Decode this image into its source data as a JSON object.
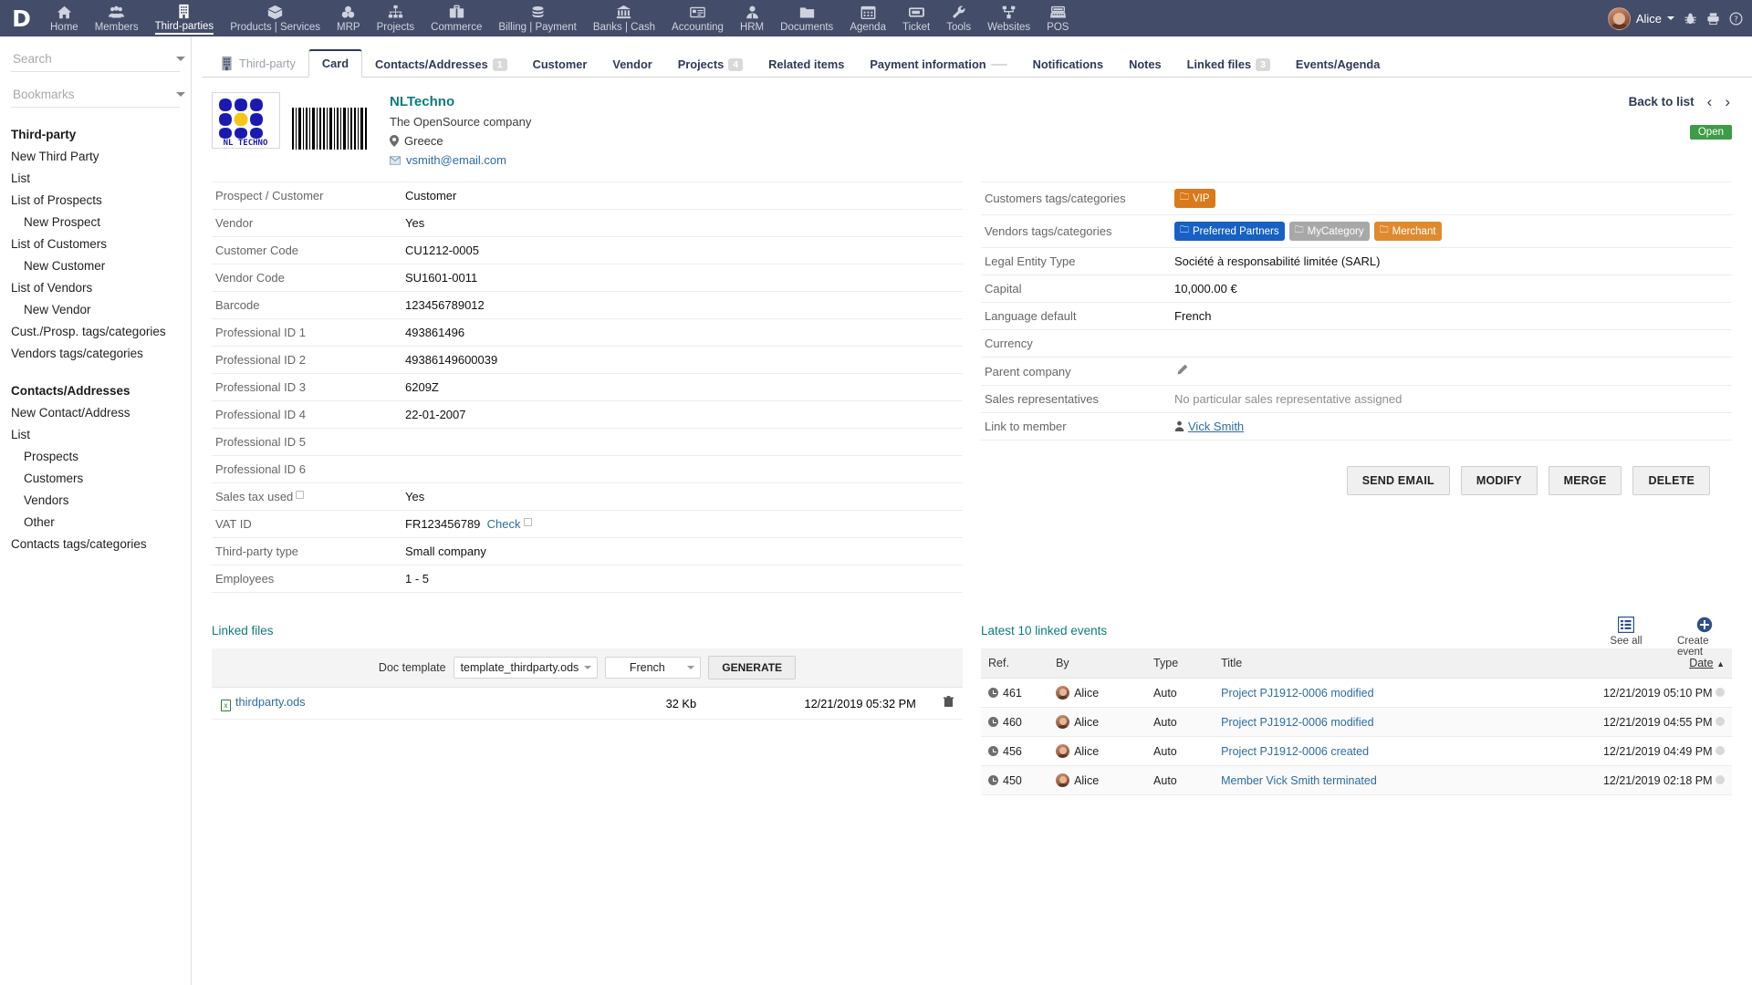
{
  "topnav": {
    "logo": "D",
    "items": [
      {
        "label": "Home",
        "icon": "home-icon",
        "active": false
      },
      {
        "label": "Members",
        "icon": "members-icon",
        "active": false
      },
      {
        "label": "Third-parties",
        "icon": "building-icon",
        "active": true
      },
      {
        "label": "Products | Services",
        "icon": "box-icon",
        "active": false
      },
      {
        "label": "MRP",
        "icon": "mrp-icon",
        "active": false
      },
      {
        "label": "Projects",
        "icon": "projects-icon",
        "active": false
      },
      {
        "label": "Commerce",
        "icon": "briefcase-icon",
        "active": false
      },
      {
        "label": "Billing | Payment",
        "icon": "coins-icon",
        "active": false
      },
      {
        "label": "Banks | Cash",
        "icon": "bank-icon",
        "active": false
      },
      {
        "label": "Accounting",
        "icon": "accounting-icon",
        "active": false
      },
      {
        "label": "HRM",
        "icon": "hrm-icon",
        "active": false
      },
      {
        "label": "Documents",
        "icon": "folder-icon",
        "active": false
      },
      {
        "label": "Agenda",
        "icon": "calendar-icon",
        "active": false
      },
      {
        "label": "Ticket",
        "icon": "ticket-icon",
        "active": false
      },
      {
        "label": "Tools",
        "icon": "wrench-icon",
        "active": false
      },
      {
        "label": "Websites",
        "icon": "websites-icon",
        "active": false
      },
      {
        "label": "POS",
        "icon": "pos-icon",
        "active": false
      }
    ],
    "user_name": "Alice",
    "right_icons": [
      "bug-icon",
      "print-icon",
      "help-icon"
    ]
  },
  "sidebar": {
    "search_placeholder": "Search",
    "bookmarks_placeholder": "Bookmarks",
    "groups": [
      {
        "title": "Third-party",
        "items": [
          {
            "label": "New Third Party",
            "indent": false
          },
          {
            "label": "List",
            "indent": false
          },
          {
            "label": "List of Prospects",
            "indent": false
          },
          {
            "label": "New Prospect",
            "indent": true
          },
          {
            "label": "List of Customers",
            "indent": false
          },
          {
            "label": "New Customer",
            "indent": true
          },
          {
            "label": "List of Vendors",
            "indent": false
          },
          {
            "label": "New Vendor",
            "indent": true
          },
          {
            "label": "Cust./Prosp. tags/categories",
            "indent": false
          },
          {
            "label": "Vendors tags/categories",
            "indent": false
          }
        ]
      },
      {
        "title": "Contacts/Addresses",
        "items": [
          {
            "label": "New Contact/Address",
            "indent": false
          },
          {
            "label": "List",
            "indent": false
          },
          {
            "label": "Prospects",
            "indent": true
          },
          {
            "label": "Customers",
            "indent": true
          },
          {
            "label": "Vendors",
            "indent": true
          },
          {
            "label": "Other",
            "indent": true
          },
          {
            "label": "Contacts tags/categories",
            "indent": false
          }
        ]
      }
    ]
  },
  "tabs": [
    {
      "label": "Third-party",
      "badge": null,
      "active": false,
      "muted": true,
      "icon": "building-icon"
    },
    {
      "label": "Card",
      "badge": null,
      "active": true,
      "muted": false
    },
    {
      "label": "Contacts/Addresses",
      "badge": "1",
      "active": false,
      "muted": false
    },
    {
      "label": "Customer",
      "badge": null,
      "active": false,
      "muted": false
    },
    {
      "label": "Vendor",
      "badge": null,
      "active": false,
      "muted": false
    },
    {
      "label": "Projects",
      "badge": "4",
      "active": false,
      "muted": false
    },
    {
      "label": "Related items",
      "badge": null,
      "active": false,
      "muted": false
    },
    {
      "label": "Payment information",
      "badge": "",
      "active": false,
      "muted": false
    },
    {
      "label": "Notifications",
      "badge": null,
      "active": false,
      "muted": false
    },
    {
      "label": "Notes",
      "badge": null,
      "active": false,
      "muted": false
    },
    {
      "label": "Linked files",
      "badge": "3",
      "active": false,
      "muted": false
    },
    {
      "label": "Events/Agenda",
      "badge": null,
      "active": false,
      "muted": false
    }
  ],
  "card_header": {
    "company_name": "NLTechno",
    "tagline": "The OpenSource company",
    "country": "Greece",
    "email": "vsmith@email.com",
    "back_to_list": "Back to list",
    "prev_arrow": "‹",
    "next_arrow": "›",
    "status": "Open",
    "status_color": "#3d9c46",
    "logo_text": "NL TECHNO"
  },
  "left_fields": [
    {
      "label": "Prospect / Customer",
      "value": "Customer"
    },
    {
      "label": "Vendor",
      "value": "Yes"
    },
    {
      "label": "Customer Code",
      "value": "CU1212-0005"
    },
    {
      "label": "Vendor Code",
      "value": "SU1601-0011"
    },
    {
      "label": "Barcode",
      "value": "123456789012"
    },
    {
      "label": "Professional ID 1",
      "value": "493861496"
    },
    {
      "label": "Professional ID 2",
      "value": "49386149600039"
    },
    {
      "label": "Professional ID 3",
      "value": "6209Z"
    },
    {
      "label": "Professional ID 4",
      "value": "22-01-2007"
    },
    {
      "label": "Professional ID 5",
      "value": ""
    },
    {
      "label": "Professional ID 6",
      "value": ""
    },
    {
      "label": "Sales tax used",
      "value": "Yes",
      "label_help": true
    },
    {
      "label": "VAT ID",
      "value": "FR123456789",
      "extra_link": "Check",
      "extra_help": true
    },
    {
      "label": "Third-party type",
      "value": "Small company"
    },
    {
      "label": "Employees",
      "value": "1 - 5"
    }
  ],
  "right_fields": {
    "customers_tags_label": "Customers tags/categories",
    "customers_tags": [
      {
        "label": "VIP",
        "color": "#d97a1a"
      }
    ],
    "vendors_tags_label": "Vendors tags/categories",
    "vendors_tags": [
      {
        "label": "Preferred Partners",
        "color": "#1761c4"
      },
      {
        "label": "MyCategory",
        "color": "#a8a8a8"
      },
      {
        "label": "Merchant",
        "color": "#e08a2e"
      }
    ],
    "rows": [
      {
        "label": "Legal Entity Type",
        "value": "Société à responsabilité limitée (SARL)"
      },
      {
        "label": "Capital",
        "value": "10,000.00 €"
      },
      {
        "label": "Language default",
        "value": "French"
      },
      {
        "label": "Currency",
        "value": ""
      },
      {
        "label": "Parent company",
        "value": "",
        "edit_icon": true
      },
      {
        "label": "Sales representatives",
        "value": "No particular sales representative assigned",
        "muted": true
      },
      {
        "label": "Link to member",
        "value": "Vick Smith",
        "link": true,
        "person_icon": true
      }
    ]
  },
  "action_buttons": [
    {
      "label": "SEND EMAIL",
      "name": "send-email-button"
    },
    {
      "label": "MODIFY",
      "name": "modify-button"
    },
    {
      "label": "MERGE",
      "name": "merge-button"
    },
    {
      "label": "DELETE",
      "name": "delete-button"
    }
  ],
  "linked_files": {
    "title": "Linked files",
    "doc_template_label": "Doc template",
    "template_value": "template_thirdparty.ods",
    "language_value": "French",
    "generate_label": "GENERATE",
    "rows": [
      {
        "name": "thirdparty.ods",
        "size": "32 Kb",
        "date": "12/21/2019 05:32 PM"
      }
    ]
  },
  "events_panel": {
    "title": "Latest 10 linked events",
    "tools": [
      {
        "label": "See all",
        "icon": "list-icon",
        "name": "see-all-button"
      },
      {
        "label": "Create event",
        "icon": "plus-icon",
        "name": "create-event-button"
      }
    ],
    "columns": [
      "Ref.",
      "By",
      "Type",
      "Title",
      "Date"
    ],
    "sorted_column": "Date",
    "sort_direction": "▲",
    "rows": [
      {
        "ref": "461",
        "by": "Alice",
        "type": "Auto",
        "title": "Project PJ1912-0006 modified",
        "date": "12/21/2019 05:10 PM"
      },
      {
        "ref": "460",
        "by": "Alice",
        "type": "Auto",
        "title": "Project PJ1912-0006 modified",
        "date": "12/21/2019 04:55 PM"
      },
      {
        "ref": "456",
        "by": "Alice",
        "type": "Auto",
        "title": "Project PJ1912-0006 created",
        "date": "12/21/2019 04:49 PM"
      },
      {
        "ref": "450",
        "by": "Alice",
        "type": "Auto",
        "title": "Member Vick Smith terminated",
        "date": "12/21/2019 02:18 PM"
      }
    ]
  }
}
